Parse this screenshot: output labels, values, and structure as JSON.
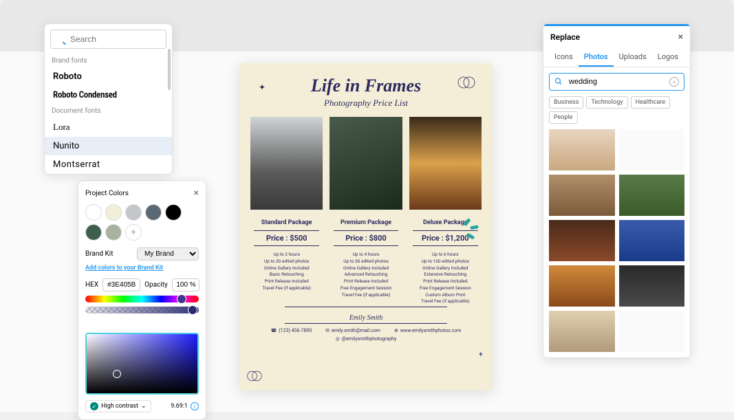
{
  "fontPicker": {
    "searchPlaceholder": "Search",
    "brandLabel": "Brand fonts",
    "docLabel": "Document fonts",
    "brandFonts": [
      "Roboto",
      "Roboto Condensed"
    ],
    "docFonts": [
      "Lora",
      "Nunito",
      "Montserrat"
    ]
  },
  "colorPicker": {
    "title": "Project Colors",
    "swatchColors1": [
      "#ffffff",
      "#f3eed8",
      "#c2c7cc",
      "#5a6973",
      "#000000"
    ],
    "swatchColors2": [
      "#3e5e4e",
      "#a8b2a0"
    ],
    "brandKitLabel": "Brand Kit",
    "brandKitValue": "My Brand",
    "addColorsLink": "Add colors to your Brand Kit",
    "hexLabel": "HEX",
    "hexValue": "#3E405B",
    "opacityLabel": "Opacity",
    "opacityValue": "100 %",
    "contrastLabel": "High contrast",
    "contrastRatio": "9.69:1"
  },
  "design": {
    "title": "Life in Frames",
    "subtitle": "Photography Price List",
    "packages": [
      {
        "name": "Standard Package",
        "price": "Price : $500",
        "features": [
          "Up to 2 hours",
          "Up to 20 edited photos",
          "Online Gallery Included",
          "Basic Retouching",
          "Print Release Included",
          "Travel Fee (if applicable)"
        ]
      },
      {
        "name": "Premium Package",
        "price": "Price : $800",
        "features": [
          "Up to 4 hours",
          "Up to 50 edited photos",
          "Online Gallery Included",
          "Advanced Retouching",
          "Print Release Included",
          "Free Engagement Session",
          "Travel Fee (if applicable)"
        ]
      },
      {
        "name": "Deluxe Package",
        "price": "Price : $1,200",
        "features": [
          "Up to 6 hours",
          "Up to 100 edited photos",
          "Online Gallery Included",
          "Extensive Retouching",
          "Print Release Included",
          "Free Engagement Session",
          "Custom Album Print",
          "Travel Fee (if applicable)"
        ]
      }
    ],
    "footerName": "Emily Smith",
    "contacts": {
      "phone": "(123) 456-7890",
      "email": "emily.smith@mail.com",
      "website": "www.emilysmithphotos.com",
      "instagram": "@emilysmithphotography"
    }
  },
  "replace": {
    "title": "Replace",
    "tabs": [
      "Icons",
      "Photos",
      "Uploads",
      "Logos"
    ],
    "activeTab": "Photos",
    "searchValue": "wedding",
    "tags": [
      "Business",
      "Technology",
      "Healthcare",
      "People"
    ]
  }
}
